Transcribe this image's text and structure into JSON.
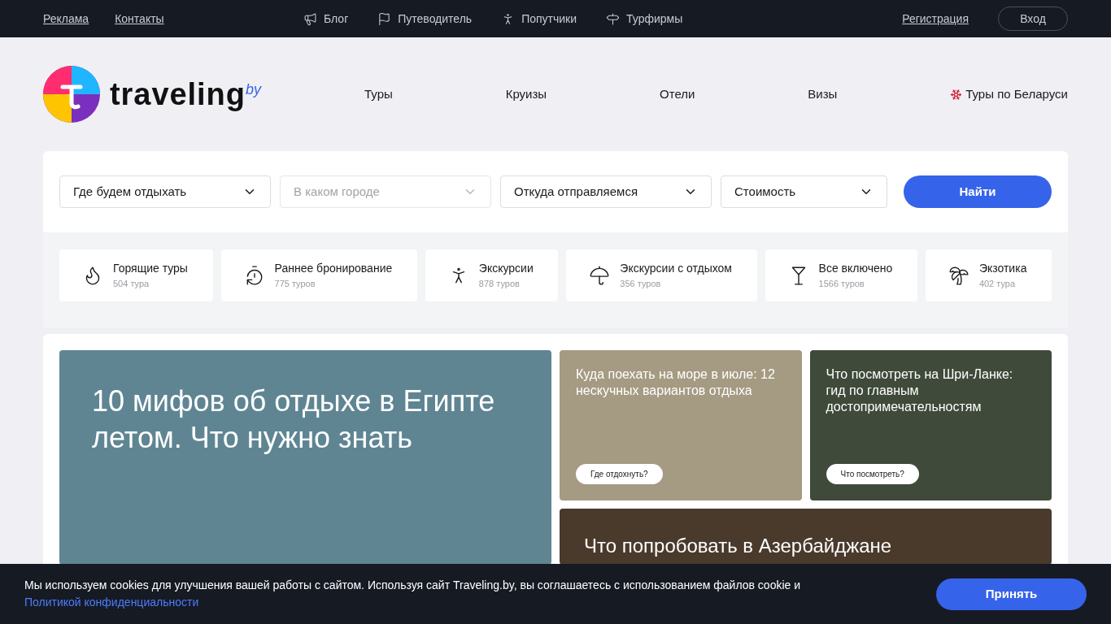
{
  "top_bar": {
    "left_links": [
      "Реклама",
      "Контакты"
    ],
    "center_links": [
      {
        "kind": "megaphone",
        "label": "Блог"
      },
      {
        "kind": "flag",
        "label": "Путеводитель"
      },
      {
        "kind": "person",
        "label": "Попутчики"
      },
      {
        "kind": "signpost",
        "label": "Турфирмы"
      }
    ],
    "register": "Регистрация",
    "login": "Вход"
  },
  "header": {
    "logo_text": "traveling",
    "logo_suffix": "by",
    "nav": [
      {
        "label": "Туры",
        "icon": false
      },
      {
        "label": "Круизы",
        "icon": false
      },
      {
        "label": "Отели",
        "icon": false
      },
      {
        "label": "Визы",
        "icon": false
      },
      {
        "label": "Туры по Беларуси",
        "icon": true
      }
    ]
  },
  "search": {
    "fields": [
      {
        "value": "Где будем отдыхать"
      },
      {
        "placeholder": "В каком городе"
      },
      {
        "value": "Откуда отправляемся"
      },
      {
        "value": "Стоимость"
      }
    ],
    "button": "Найти"
  },
  "categories": [
    {
      "kind": "flame",
      "title": "Горящие туры",
      "count": "504 тура"
    },
    {
      "kind": "clock",
      "title": "Раннее бронирование",
      "count": "775 туров"
    },
    {
      "kind": "person",
      "title": "Экскурсии",
      "count": "878 туров"
    },
    {
      "kind": "beach",
      "title": "Экскурсии с отдыхом",
      "count": "356 туров"
    },
    {
      "kind": "cocktail",
      "title": "Все включено",
      "count": "1566 туров"
    },
    {
      "kind": "palm",
      "title": "Экзотика",
      "count": "402 тура"
    }
  ],
  "articles": [
    {
      "title": "10 мифов об отдыхе в Египте летом. Что нужно знать"
    },
    {
      "title": "Куда поехать на море в июле: 12 нескучных вариантов отдыха",
      "tag": "Где отдохнуть?"
    },
    {
      "title": "Что посмотреть на Шри-Ланке: гид по главным достопримечательностям",
      "tag": "Что посмотреть?"
    },
    {
      "title": "Что попробовать в Азербайджане"
    }
  ],
  "cookie": {
    "text": "Мы используем cookies для улучшения вашей работы с сайтом. Используя сайт Traveling.by, вы соглашаетесь с использованием файлов cookie и",
    "link": "Политикой конфиденциальности",
    "button": "Принять"
  }
}
